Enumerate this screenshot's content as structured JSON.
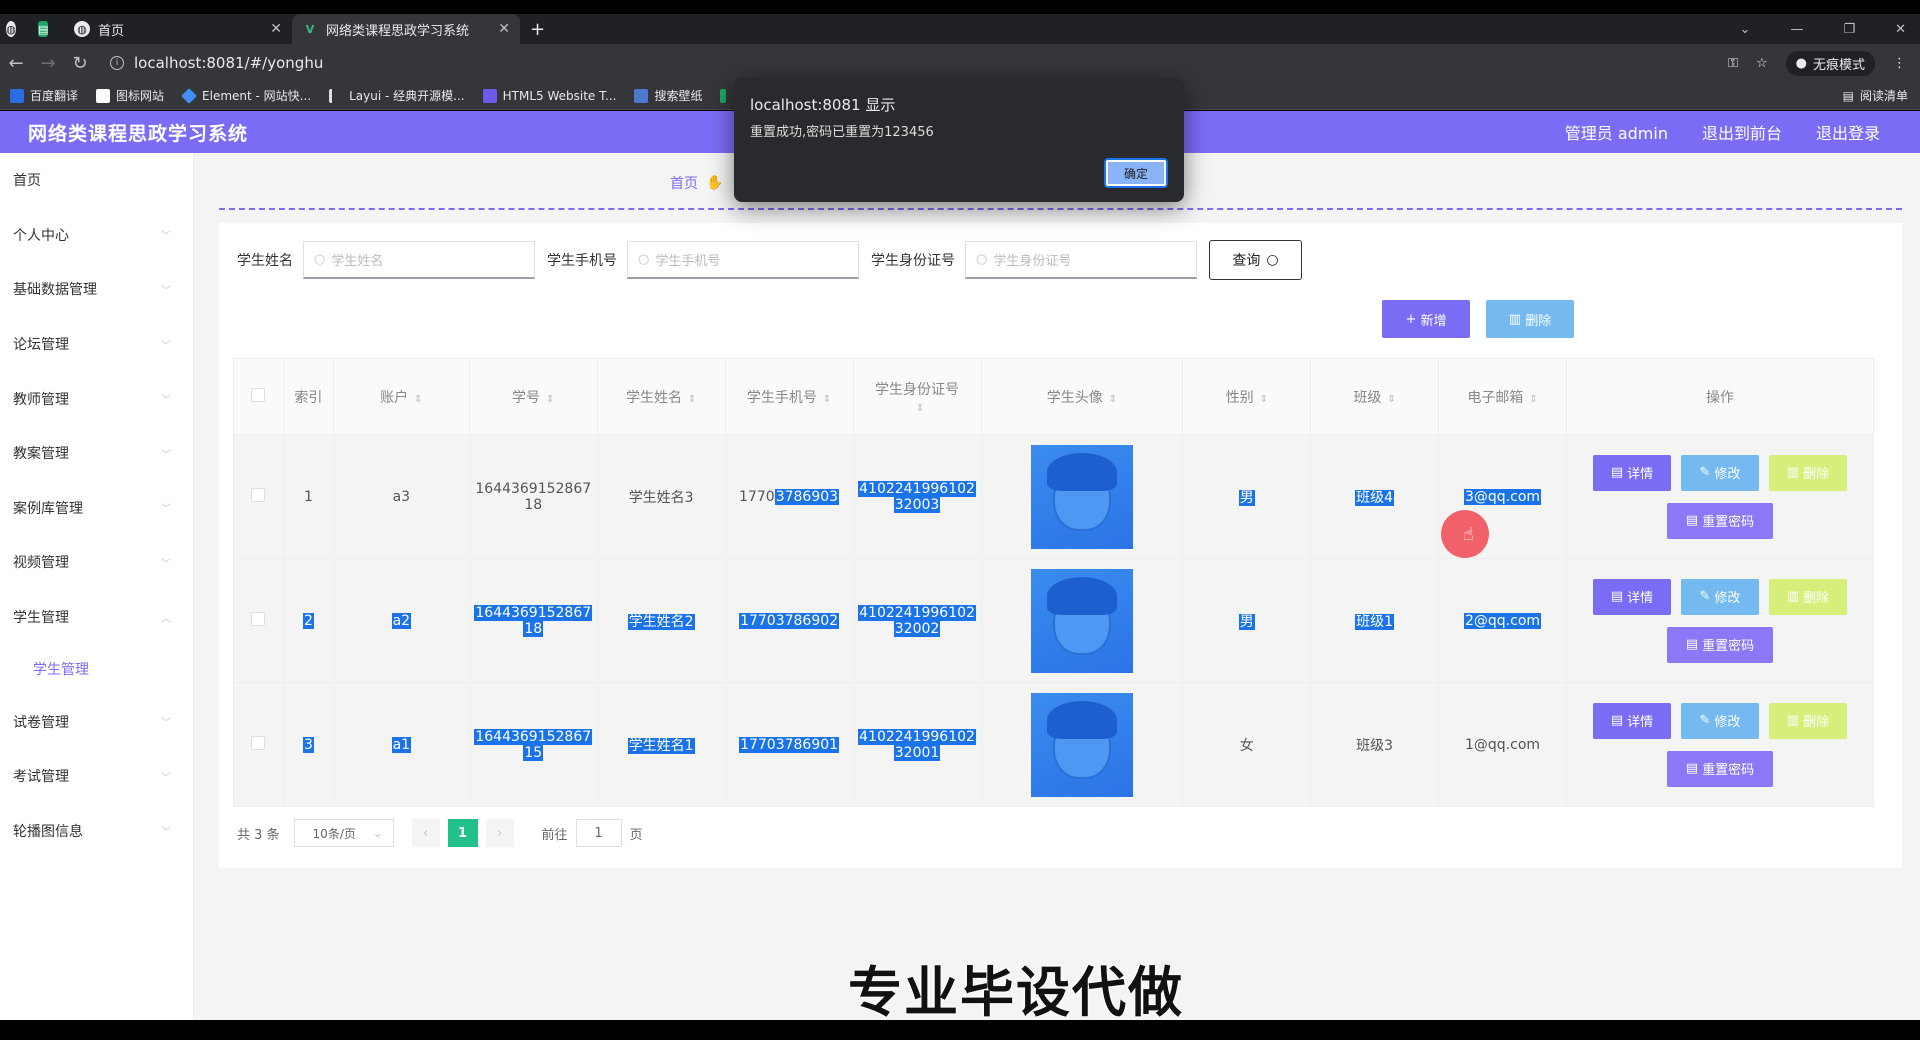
{
  "browser": {
    "tabs": [
      {
        "label": ""
      },
      {
        "label": "首页"
      },
      {
        "label": "网络类课程思政学习系统"
      }
    ],
    "url": "localhost:8081/#/yonghu",
    "incognito_label": "无痕模式",
    "bookmarks": [
      "百度翻译",
      "图标网站",
      "Element - 网站快...",
      "Layui - 经典开源模...",
      "HTML5 Website T...",
      "搜索壁纸"
    ],
    "reading_list": "阅读清单"
  },
  "dialog": {
    "title": "localhost:8081 显示",
    "message": "重置成功,密码已重置为123456",
    "ok_label": "确定"
  },
  "app": {
    "title": "网络类课程思政学习系统",
    "nav": [
      "管理员 admin",
      "退出到前台",
      "退出登录"
    ],
    "accent": "#7b6cf6"
  },
  "sidebar": {
    "items": [
      "首页",
      "个人中心",
      "基础数据管理",
      "论坛管理",
      "教师管理",
      "教案管理",
      "案例库管理",
      "视频管理",
      "学生管理",
      "试卷管理",
      "考试管理",
      "轮播图信息"
    ],
    "sub_item": "学生管理"
  },
  "breadcrumb": "首页",
  "search": {
    "name_label": "学生姓名",
    "name_placeholder": "学生姓名",
    "phone_label": "学生手机号",
    "phone_placeholder": "学生手机号",
    "id_label": "学生身份证号",
    "id_placeholder": "学生身份证号",
    "query_label": "查询"
  },
  "actions": {
    "add": "新增",
    "delete": "删除"
  },
  "table": {
    "headers": [
      "索引",
      "账户",
      "学号",
      "学生姓名",
      "学生手机号",
      "学生身份证号",
      "学生头像",
      "性别",
      "班级",
      "电子邮箱",
      "操作"
    ],
    "rows": [
      {
        "index": "1",
        "account": "a3",
        "sno_a": "1644369152867",
        "sno_b": "18",
        "name": "学生姓名3",
        "phone_a": "1770",
        "phone_b": "3786903",
        "idno_a": "4102241996102",
        "idno_b": "32003",
        "gender": "男",
        "class": "班级4",
        "email": "3@qq.com"
      },
      {
        "index": "2",
        "account": "a2",
        "sno_a": "1644369152867",
        "sno_b": "18",
        "name": "学生姓名2",
        "phone_a": "",
        "phone_b": "17703786902",
        "idno_a": "4102241996102",
        "idno_b": "32002",
        "gender": "男",
        "class": "班级1",
        "email": "2@qq.com"
      },
      {
        "index": "3",
        "account": "a1",
        "sno_a": "1644369152867",
        "sno_b": "15",
        "name": "学生姓名1",
        "phone_a": "",
        "phone_b": "17703786901",
        "idno_a": "4102241996102",
        "idno_b": "32001",
        "gender": "女",
        "class": "班级3",
        "email": "1@qq.com"
      }
    ],
    "ops": {
      "detail": "详情",
      "edit": "修改",
      "delete": "删除",
      "reset": "重置密码"
    }
  },
  "pager": {
    "total": "共 3 条",
    "size": "10条/页",
    "page": "1",
    "goto": "前往",
    "goto_value": "1",
    "page_unit": "页"
  },
  "watermark": "专业毕设代做"
}
